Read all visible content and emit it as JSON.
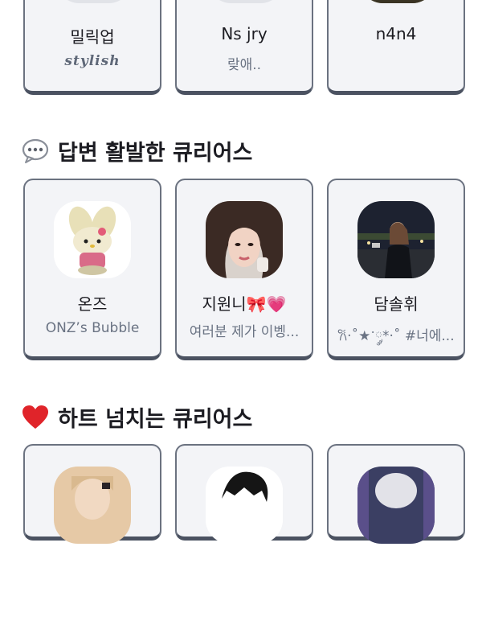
{
  "top_row": [
    {
      "name": "밀릭업",
      "sub": "stylish"
    },
    {
      "name": "Ns jry",
      "sub": "랒애.."
    },
    {
      "name": "n4n4",
      "sub": ""
    }
  ],
  "sections": [
    {
      "title": "답변 활발한 큐리어스",
      "icon": "speech-bubble-icon",
      "cards": [
        {
          "name": "온즈",
          "sub": "ONZ’s Bubble"
        },
        {
          "name": "지원니🎀💗",
          "sub": "여러분 제가 이벵..."
        },
        {
          "name": "담솔휘",
          "sub": "𐙚·˚★ॱ༘*·˚ #너에..."
        }
      ]
    },
    {
      "title": "하트 넘치는 큐리어스",
      "icon": "red-heart-icon",
      "cards": [
        {
          "name": "",
          "sub": ""
        },
        {
          "name": "",
          "sub": ""
        },
        {
          "name": "",
          "sub": ""
        }
      ]
    }
  ],
  "colors": {
    "card_bg": "#f3f4f7",
    "card_border": "#6b7280",
    "subtitle": "#6a7383",
    "heart": "#e0242a"
  }
}
